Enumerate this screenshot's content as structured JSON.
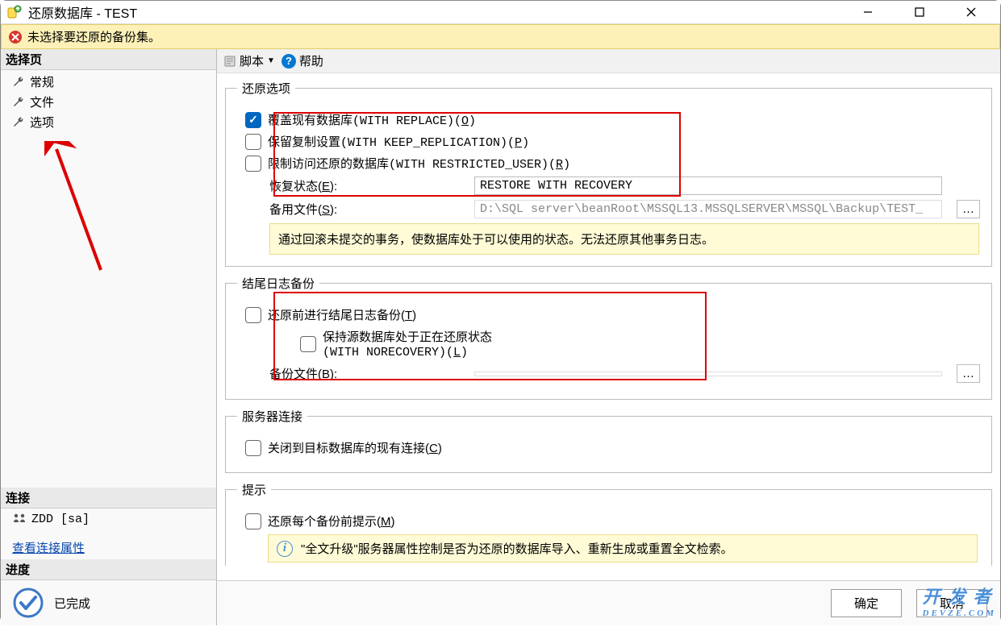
{
  "window": {
    "title": "还原数据库 - TEST"
  },
  "warning": {
    "text": "未选择要还原的备份集。"
  },
  "sidebar": {
    "select_page": "选择页",
    "items": [
      "常规",
      "文件",
      "选项"
    ],
    "connection_title": "连接",
    "connection_value": "ZDD [sa]",
    "view_conn_link": "查看连接属性",
    "progress_title": "进度",
    "progress_value": "已完成"
  },
  "toolbar": {
    "script": "脚本",
    "help": "帮助"
  },
  "restore_options": {
    "legend": "还原选项",
    "overwrite": "覆盖现有数据库(WITH REPLACE)(",
    "overwrite_hotkey": "O",
    "keep_replication": "保留复制设置(WITH KEEP_REPLICATION)(",
    "keep_replication_hotkey": "P",
    "restricted": "限制访问还原的数据库(WITH RESTRICTED_USER)(",
    "restricted_hotkey": "R",
    "close_paren": ")",
    "recovery_state_label": "恢复状态(",
    "recovery_hotkey": "E",
    "colon": "):",
    "recovery_value": "RESTORE WITH RECOVERY",
    "standby_label": "备用文件(",
    "standby_hotkey": "S",
    "standby_value": "D:\\SQL server\\beanRoot\\MSSQL13.MSSQLSERVER\\MSSQL\\Backup\\TEST_",
    "note": "通过回滚未提交的事务，使数据库处于可以使用的状态。无法还原其他事务日志。"
  },
  "tail_log": {
    "legend": "结尾日志备份",
    "before": "还原前进行结尾日志备份(",
    "before_hotkey": "T",
    "keep_source_line1": "保持源数据库处于正在还原状态",
    "keep_source_line2": "(WITH NORECOVERY)(",
    "keep_source_hotkey": "L",
    "close_paren": ")",
    "backup_file_label": "备份文件(",
    "backup_file_hotkey": "B",
    "colon": "):"
  },
  "server_conn": {
    "legend": "服务器连接",
    "close_conn": "关闭到目标数据库的现有连接(",
    "close_conn_hotkey": "C",
    "close_paren": ")"
  },
  "prompt": {
    "legend": "提示",
    "each_backup": "还原每个备份前提示(",
    "each_backup_hotkey": "M",
    "close_paren": ")",
    "hint": "\"全文升级\"服务器属性控制是否为还原的数据库导入、重新生成或重置全文检索。"
  },
  "footer": {
    "ok": "确定",
    "cancel": "取消"
  },
  "watermark": {
    "main": "开 发 者",
    "sub": "DEVZE.COM"
  }
}
